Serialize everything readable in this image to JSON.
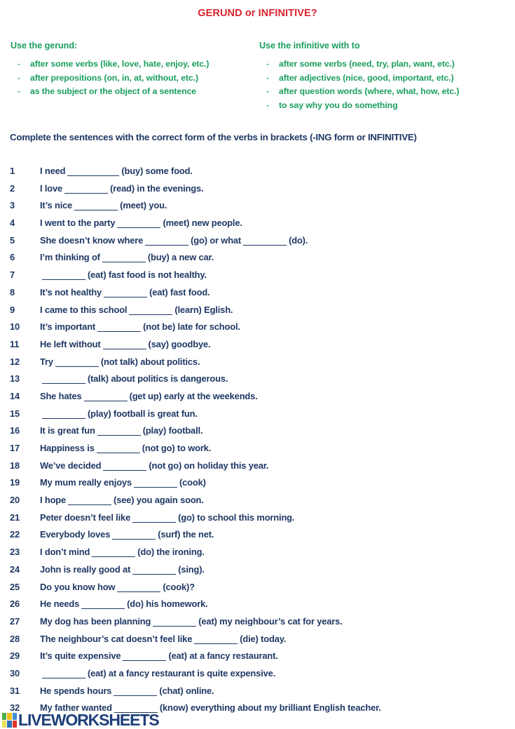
{
  "title": "GERUND or INFINITIVE?",
  "colors": {
    "title_red": "#d9232e",
    "rule_green": "#1a9e5e",
    "body_navy": "#1f3864",
    "logo_blue": "#1f3f7a",
    "background": "#ffffff"
  },
  "rules": {
    "gerund": {
      "heading": "Use the gerund:",
      "items": [
        "after some verbs (like, love, hate, enjoy,  etc.)",
        "after prepositions (on, in, at, without, etc.)",
        "as the subject or the object of a sentence"
      ]
    },
    "infinitive": {
      "heading": "Use the infinitive with to",
      "items": [
        "after some verbs (need, try, plan, want, etc.)",
        "after adjectives (nice, good, important, etc.)",
        "after question words (where, what, how, etc.)",
        "to say why you do something"
      ]
    },
    "bullet_dash": "-"
  },
  "instruction": "Complete the sentences with the correct form of the verbs in brackets (-ING form or INFINITIVE)",
  "exercises": [
    {
      "num": "1",
      "parts": [
        {
          "t": "I need"
        },
        {
          "blank": "long"
        },
        {
          "t": "(buy) some food."
        }
      ]
    },
    {
      "num": "2",
      "parts": [
        {
          "t": "I love"
        },
        {
          "blank": "med"
        },
        {
          "t": "(read) in the evenings."
        }
      ]
    },
    {
      "num": "3",
      "parts": [
        {
          "t": "It’s nice"
        },
        {
          "blank": "med"
        },
        {
          "t": "(meet) you."
        }
      ]
    },
    {
      "num": "4",
      "parts": [
        {
          "t": "I went to the party"
        },
        {
          "blank": "med"
        },
        {
          "t": "(meet) new people."
        }
      ]
    },
    {
      "num": "5",
      "parts": [
        {
          "t": "She doesn’t know where"
        },
        {
          "blank": "med"
        },
        {
          "t": "(go) or what"
        },
        {
          "blank": "med"
        },
        {
          "t": "(do)."
        }
      ]
    },
    {
      "num": "6",
      "parts": [
        {
          "t": "I’m thinking of"
        },
        {
          "blank": "med"
        },
        {
          "t": "(buy) a new car."
        }
      ]
    },
    {
      "num": "7",
      "parts": [
        {
          "blank": "med"
        },
        {
          "t": "(eat) fast food is not healthy."
        }
      ]
    },
    {
      "num": "8",
      "parts": [
        {
          "t": "It’s not healthy"
        },
        {
          "blank": "med"
        },
        {
          "t": "(eat) fast food."
        }
      ]
    },
    {
      "num": "9",
      "parts": [
        {
          "t": "I came to this school"
        },
        {
          "blank": "med"
        },
        {
          "t": "(learn) Eglish."
        }
      ]
    },
    {
      "num": "10",
      "parts": [
        {
          "t": "It’s important"
        },
        {
          "blank": "med"
        },
        {
          "t": "(not be) late for school."
        }
      ]
    },
    {
      "num": "11",
      "parts": [
        {
          "t": "He left without"
        },
        {
          "blank": "med"
        },
        {
          "t": "(say) goodbye."
        }
      ]
    },
    {
      "num": "12",
      "parts": [
        {
          "t": "Try"
        },
        {
          "blank": "med"
        },
        {
          "t": "(not talk) about politics."
        }
      ]
    },
    {
      "num": "13",
      "parts": [
        {
          "blank": "med"
        },
        {
          "t": "(talk) about politics is dangerous."
        }
      ]
    },
    {
      "num": "14",
      "parts": [
        {
          "t": "She hates"
        },
        {
          "blank": "med"
        },
        {
          "t": "(get up) early at the weekends."
        }
      ]
    },
    {
      "num": "15",
      "parts": [
        {
          "blank": "med"
        },
        {
          "t": "(play) football is great fun."
        }
      ]
    },
    {
      "num": "16",
      "parts": [
        {
          "t": "It is great fun"
        },
        {
          "blank": "med"
        },
        {
          "t": "(play) football."
        }
      ]
    },
    {
      "num": "17",
      "parts": [
        {
          "t": "Happiness is"
        },
        {
          "blank": "med"
        },
        {
          "t": "(not go) to work."
        }
      ]
    },
    {
      "num": "18",
      "parts": [
        {
          "t": "We’ve decided"
        },
        {
          "blank": "med"
        },
        {
          "t": "(not go) on holiday this year."
        }
      ]
    },
    {
      "num": "19",
      "parts": [
        {
          "t": "My mum really enjoys"
        },
        {
          "blank": "med"
        },
        {
          "t": "(cook)"
        }
      ]
    },
    {
      "num": "20",
      "parts": [
        {
          "t": "I hope"
        },
        {
          "blank": "med"
        },
        {
          "t": "(see) you again soon."
        }
      ]
    },
    {
      "num": "21",
      "parts": [
        {
          "t": "Peter doesn’t feel like"
        },
        {
          "blank": "med"
        },
        {
          "t": "(go) to school this morning."
        }
      ]
    },
    {
      "num": "22",
      "parts": [
        {
          "t": "Everybody loves"
        },
        {
          "blank": "med"
        },
        {
          "t": "(surf) the net."
        }
      ]
    },
    {
      "num": "23",
      "parts": [
        {
          "t": "I don’t mind"
        },
        {
          "blank": "med"
        },
        {
          "t": "(do) the ironing."
        }
      ]
    },
    {
      "num": "24",
      "parts": [
        {
          "t": "John is really good at"
        },
        {
          "blank": "med"
        },
        {
          "t": "(sing)."
        }
      ]
    },
    {
      "num": "25",
      "parts": [
        {
          "t": "Do you know how"
        },
        {
          "blank": "med"
        },
        {
          "t": "(cook)?"
        }
      ]
    },
    {
      "num": "26",
      "parts": [
        {
          "t": "He needs"
        },
        {
          "blank": "med"
        },
        {
          "t": "(do) his homework."
        }
      ]
    },
    {
      "num": "27",
      "parts": [
        {
          "t": "My dog has been planning"
        },
        {
          "blank": "med"
        },
        {
          "t": "(eat) my neighbour’s cat for years."
        }
      ]
    },
    {
      "num": "28",
      "parts": [
        {
          "t": "The neighbour’s cat doesn’t feel like"
        },
        {
          "blank": "med"
        },
        {
          "t": "(die) today."
        }
      ]
    },
    {
      "num": "29",
      "parts": [
        {
          "t": "It’s quite expensive"
        },
        {
          "blank": "med"
        },
        {
          "t": "(eat) at a fancy restaurant."
        }
      ]
    },
    {
      "num": "30",
      "parts": [
        {
          "blank": "med"
        },
        {
          "t": "(eat) at a fancy restaurant is quite expensive."
        }
      ]
    },
    {
      "num": "31",
      "parts": [
        {
          "t": "He spends hours"
        },
        {
          "blank": "med"
        },
        {
          "t": "(chat) online."
        }
      ]
    },
    {
      "num": "32",
      "parts": [
        {
          "t": "My father wanted"
        },
        {
          "blank": "med"
        },
        {
          "t": "(know) everything about my brilliant English teacher."
        }
      ]
    }
  ],
  "footer": {
    "logo_text": "LIVEWORKSHEETS",
    "logo_swatches": [
      "#4fae4a",
      "#f2c019",
      "#3f8fd0",
      "#e8e352",
      "#2f6fb5",
      "#e0342c"
    ]
  }
}
